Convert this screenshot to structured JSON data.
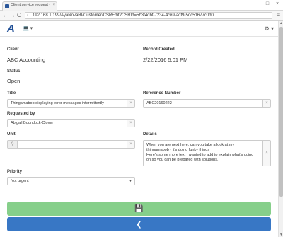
{
  "browser": {
    "tab_title": "Client service request - A",
    "tab_close": "×",
    "window_controls": [
      "–",
      "□",
      "×"
    ],
    "url": "192.168.1.199/AyaNovaRI/Customer/CSREdit?CSRId=5b3f4dbf-7234-4c69-adf9-5dc51677c0d0",
    "nav_back": "←",
    "nav_forward": "→",
    "nav_reload": "C",
    "menu": "≡"
  },
  "app": {
    "logo": "A",
    "laptop_icon": "💻 ▾",
    "gear_icon": "⚙ ▾"
  },
  "form": {
    "client_label": "Client",
    "client_value": "ABC Accounting",
    "record_created_label": "Record Created",
    "record_created_value": "2/22/2016 5:01 PM",
    "status_label": "Status",
    "status_value": "Open",
    "title_label": "Title",
    "title_value": "Thingamabob displaying error messages intermittently",
    "reference_label": "Reference Number",
    "reference_value": "ABC20160222",
    "requested_by_label": "Requested by",
    "requested_by_value": "Abigail Boondock-Clover",
    "unit_label": "Unit",
    "unit_value": "-",
    "details_label": "Details",
    "details_value": "When you are next here, can you take a look at my thingamabob - it's doing funky things\nHere's some more text I wanted to add to explain what's going on so you can be prepared with solutions.",
    "priority_label": "Priority",
    "priority_value": "Not urgent",
    "clear_symbol": "×"
  },
  "buttons": {
    "save_icon": "💾",
    "back_icon": "❮"
  },
  "colors": {
    "save": "#86cf8a",
    "back": "#3877c5",
    "logo": "#1f4e95"
  }
}
